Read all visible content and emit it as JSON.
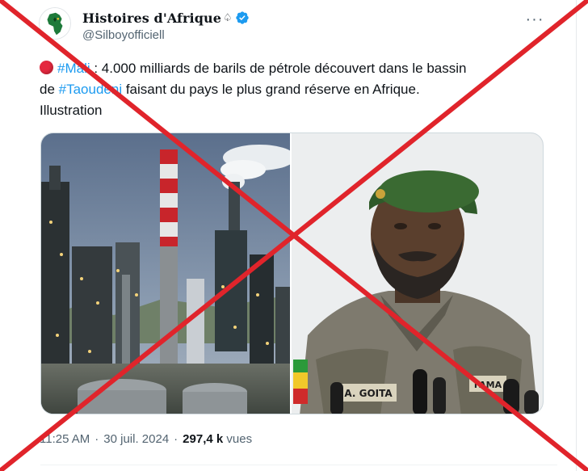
{
  "account": {
    "display_name": "Histoires d'Afrique",
    "name_symbol": "♤",
    "handle": "@Silboyofficiell"
  },
  "more_label": "···",
  "tweet": {
    "hashtag_mali": "#Mali",
    "line1_rest": " : 4.000 milliards de barils de pétrole découvert dans le bassin",
    "line2_prefix": "de ",
    "hashtag_taoudeni": "#Taoudeni",
    "line2_rest": " faisant du pays le plus grand réserve en Afrique.",
    "line3": "Illustration"
  },
  "media": {
    "uniform_name": "A. GOITA",
    "uniform_unit": "FAMA"
  },
  "meta": {
    "time": "11:25 AM",
    "separator": "·",
    "date": "30 juil. 2024",
    "views_count": "297,4 k",
    "views_label": "vues"
  },
  "colors": {
    "link": "#1d9bf0",
    "secondary_text": "#536471",
    "cross": "#e0242b",
    "verified": "#1d9bf0"
  }
}
